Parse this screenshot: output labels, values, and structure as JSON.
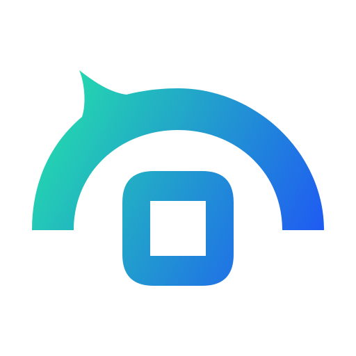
{
  "logo": {
    "icon_name": "app-logo-icon",
    "colors": {
      "background": "#ffffff",
      "gradient_start": "#24E3A8",
      "gradient_end": "#1F5BF2"
    }
  }
}
